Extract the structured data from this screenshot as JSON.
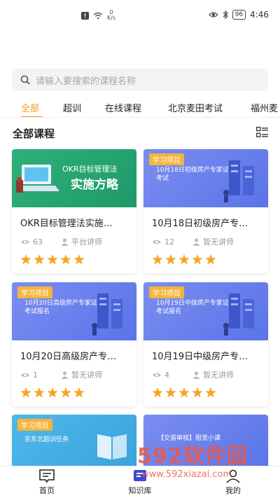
{
  "status_bar": {
    "speed_value": "0",
    "speed_unit": "K/s",
    "battery": "96",
    "time": "4:46"
  },
  "search": {
    "placeholder": "请输入要搜索的课程名称"
  },
  "tabs": [
    {
      "label": "全部",
      "active": true
    },
    {
      "label": "超训"
    },
    {
      "label": "在线课程"
    },
    {
      "label": "北京麦田考试"
    },
    {
      "label": "福州麦"
    }
  ],
  "section": {
    "title": "全部课程"
  },
  "courses": [
    {
      "title": "OKR目标管理法实施…",
      "views": "63",
      "teacher": "平台讲师",
      "thumb_line1": "OKR目标管理法",
      "thumb_line2": "实施方略"
    },
    {
      "title": "10月18日初级房产专…",
      "views": "12",
      "teacher": "暂无讲师",
      "badge": "学习项目",
      "thumb_text": "10月18日初级房产专家证考试"
    },
    {
      "title": "10月20日高级房产专…",
      "views": "1",
      "teacher": "暂无讲师",
      "badge": "学习项目",
      "thumb_text": "10月20日高级房产专家证考试报名"
    },
    {
      "title": "10月19日中级房产专…",
      "views": "4",
      "teacher": "暂无讲师",
      "badge": "学习项目",
      "thumb_text": "10月19日中级房产专家证考试报名"
    },
    {
      "badge": "学习项目",
      "thumb_text": "京东北超训任务"
    },
    {
      "thumb_text": "【交易审核】租赁小课"
    }
  ],
  "bottom_nav": {
    "home": "首页",
    "knowledge": "知识库",
    "mine": "我的"
  },
  "watermark": {
    "brand": "592软件园",
    "url": "www.592xiazai.com"
  },
  "colors": {
    "accent": "#f29a1a",
    "star": "#f6a623",
    "card_blue": "#6b80ee",
    "card_green": "#24a470"
  }
}
